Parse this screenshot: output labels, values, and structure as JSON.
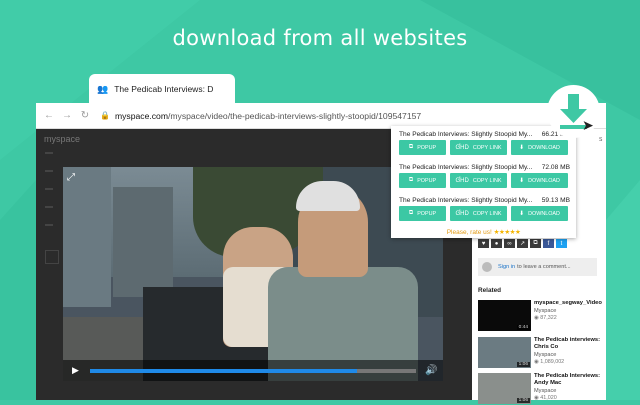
{
  "headline": "download from all websites",
  "colors": {
    "accent": "#3ec8a4",
    "button": "#3cc8a4",
    "progress": "#1f8ae8",
    "rate": "#e29a13"
  },
  "tab": {
    "icon": "people-icon",
    "title": "The Pedicab Interviews: D"
  },
  "address_bar": {
    "back_icon": "back-arrow-icon",
    "forward_icon": "forward-arrow-icon",
    "reload_icon": "reload-icon",
    "lock_icon": "lock-icon",
    "url_host": "myspace.com",
    "url_path": "/myspace/video/the-pedicab-interviews-slightly-stoopid/109547157"
  },
  "site": {
    "logo": "myspace"
  },
  "video": {
    "progress": 0.82
  },
  "download_popup": {
    "items": [
      {
        "title": "The Pedicab Interviews: Slightly Stoopid My...",
        "size": "66.21 MB"
      },
      {
        "title": "The Pedicab Interviews: Slightly Stoopid My...",
        "size": "72.08 MB"
      },
      {
        "title": "The Pedicab Interviews: Slightly Stoopid My...",
        "size": "59.13 MB"
      }
    ],
    "popup_label": "POPUP",
    "copy_label": "COPY LINK",
    "quality_label": "ƓHD",
    "download_label": "DOWNLOAD",
    "rate_text": "Please, rate us!",
    "stars": "★★★★★"
  },
  "right_panel": {
    "sign_in": "Sign in",
    "comment_placeholder": "to leave a comment...",
    "related_heading": "Related",
    "related": [
      {
        "title": "myspace_segway_Video",
        "by": "Myspace",
        "views": "87,322",
        "duration": "0:44"
      },
      {
        "title": "The Pedicab interviews: Chris Co",
        "by": "Myspace",
        "views": "1,089,002",
        "duration": "1:06"
      },
      {
        "title": "The Pedicab Interviews: Andy Mac",
        "by": "Myspace",
        "views": "41,020",
        "duration": "1:06"
      }
    ]
  }
}
